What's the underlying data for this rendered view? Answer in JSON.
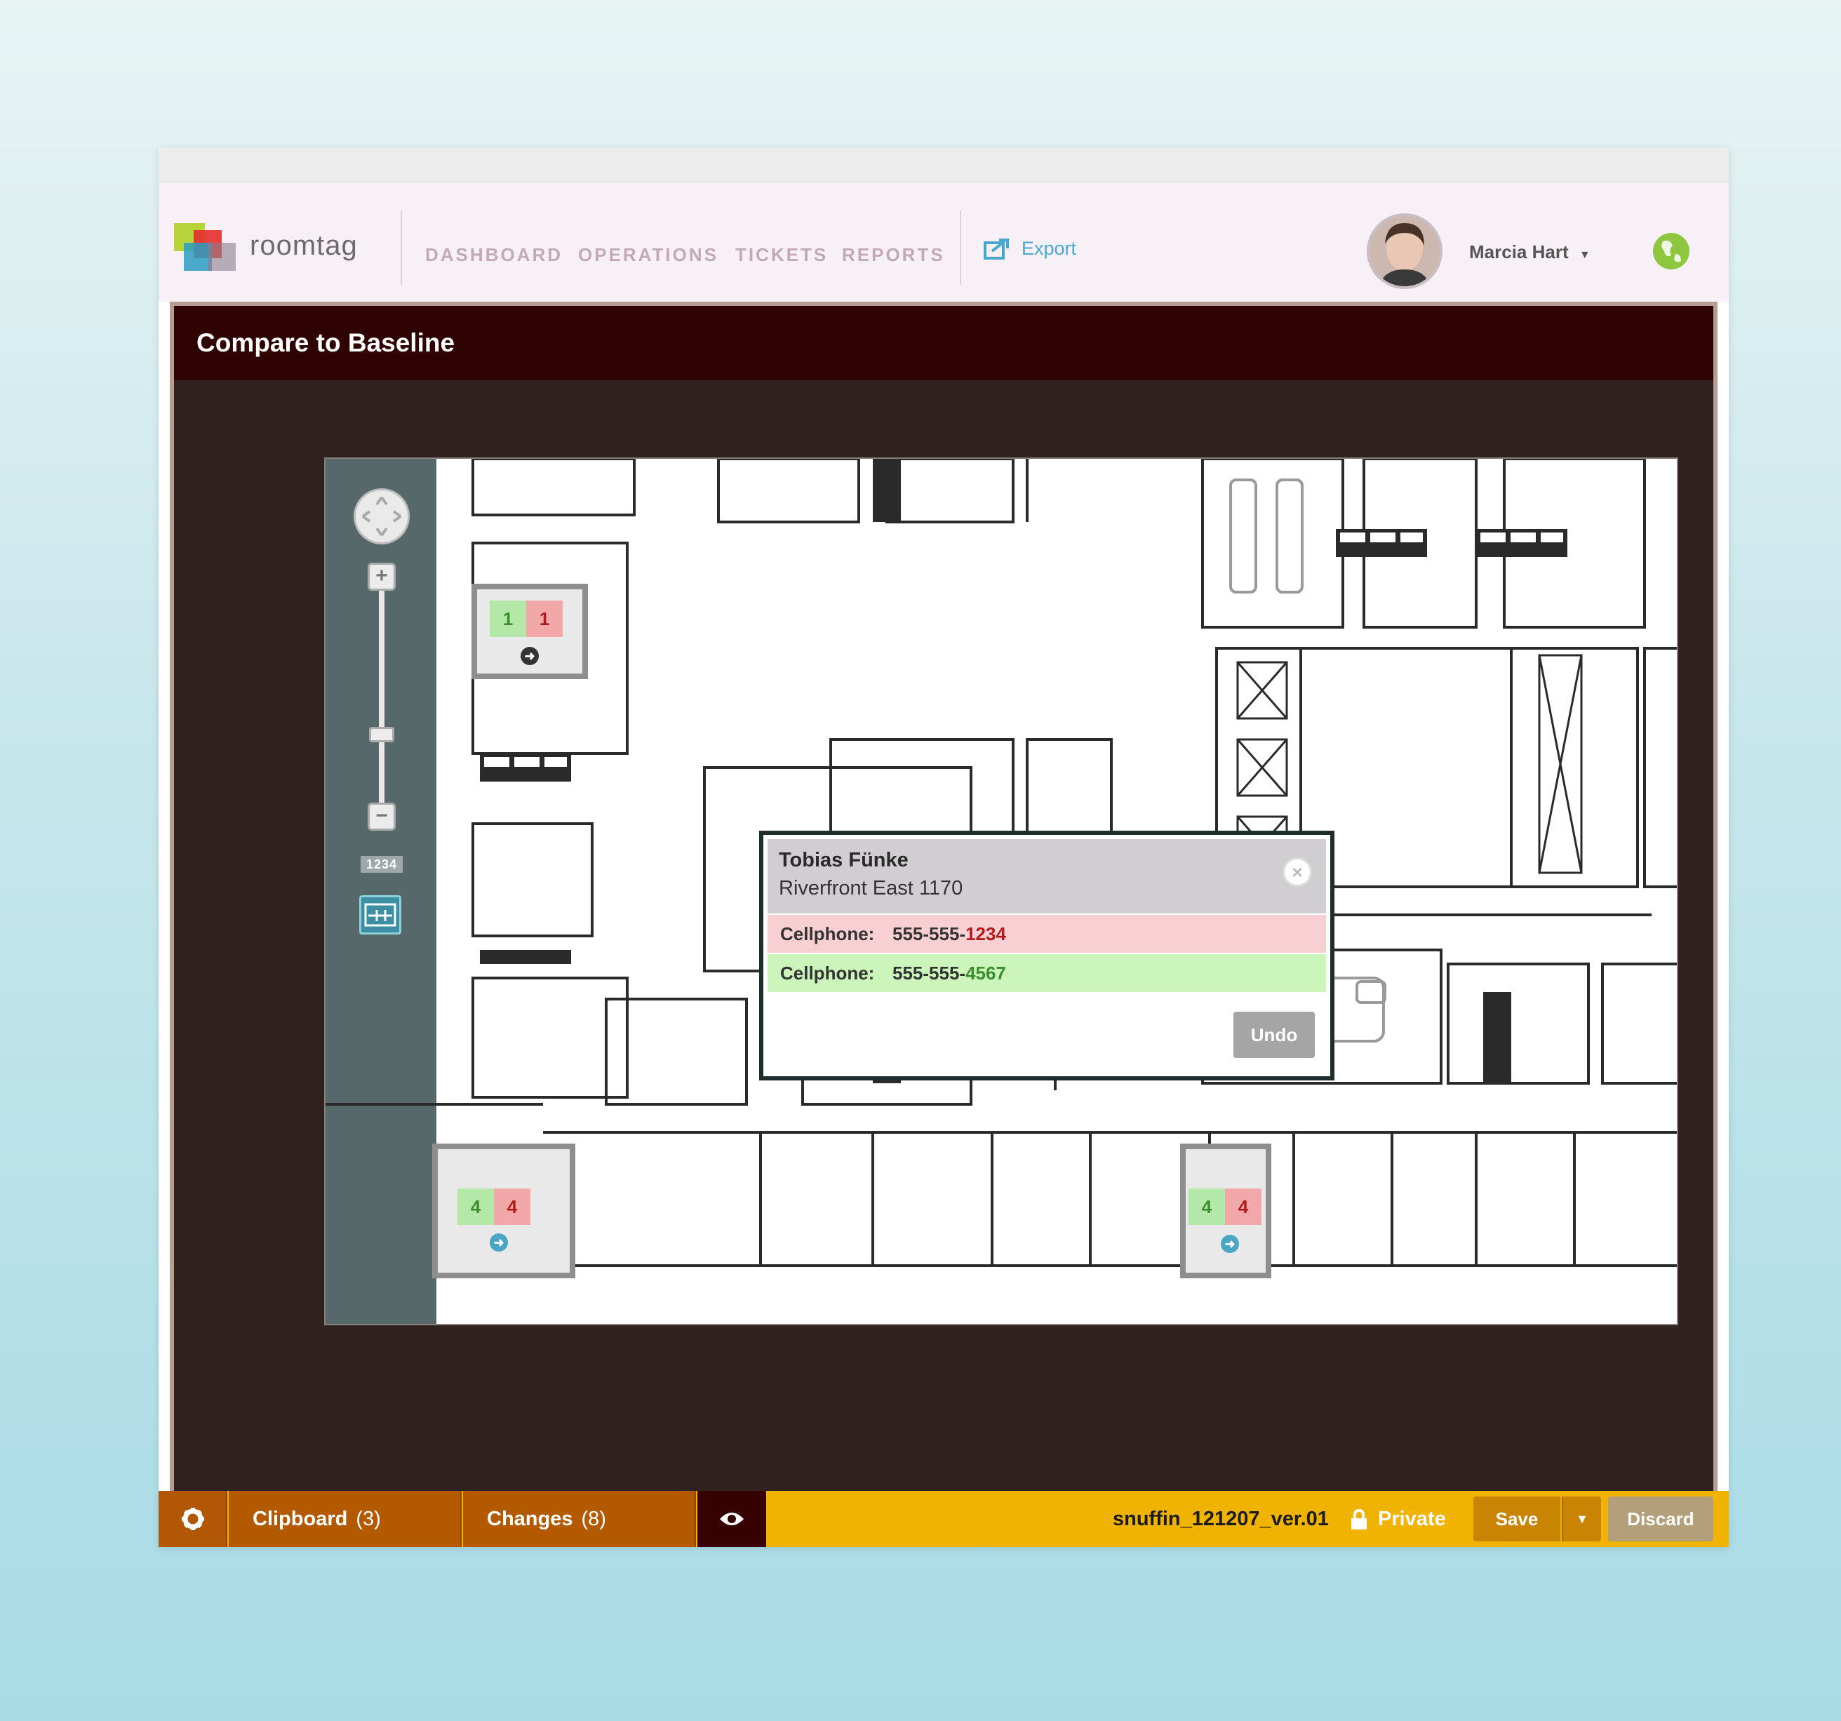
{
  "app": {
    "brand": "roomtag"
  },
  "nav": {
    "items": [
      {
        "label": "DASHBOARD"
      },
      {
        "label": "OPERATIONS"
      },
      {
        "label": "TICKETS"
      },
      {
        "label": "REPORTS"
      }
    ],
    "export_label": "Export"
  },
  "user": {
    "name": "Marcia Hart"
  },
  "panel": {
    "title": "Compare to Baseline"
  },
  "map": {
    "number_tag": "1234",
    "badges": [
      {
        "added": "1",
        "removed": "1"
      },
      {
        "added": "4",
        "removed": "4"
      },
      {
        "added": "4",
        "removed": "4"
      }
    ]
  },
  "popup": {
    "name": "Tobias Fünke",
    "location": "Riverfront East 1170",
    "rows": [
      {
        "label": "Cellphone:",
        "value_prefix": "555-555-",
        "value_suffix": "1234",
        "status": "removed"
      },
      {
        "label": "Cellphone:",
        "value_prefix": "555-555-",
        "value_suffix": "4567",
        "status": "added"
      }
    ],
    "undo_label": "Undo"
  },
  "bottombar": {
    "clipboard_label": "Clipboard",
    "clipboard_count": "(3)",
    "changes_label": "Changes",
    "changes_count": "(8)",
    "filename": "snuffin_121207_ver.01",
    "privacy": "Private",
    "save_label": "Save",
    "discard_label": "Discard"
  },
  "colors": {
    "header_bar": "#300303",
    "bottom_bar": "#f1b302",
    "tab_bg": "#b35a00",
    "added": "#b3e8a9",
    "removed": "#f2a8a8",
    "link": "#49a7cf"
  },
  "icons": [
    "roomtag-logo",
    "export-icon",
    "chevron-down-icon",
    "globe-icon",
    "pan-control-icon",
    "zoom-in-icon",
    "zoom-out-icon",
    "compare-tool-icon",
    "arrow-right-icon",
    "close-icon",
    "gear-icon",
    "eye-icon",
    "lock-icon"
  ]
}
